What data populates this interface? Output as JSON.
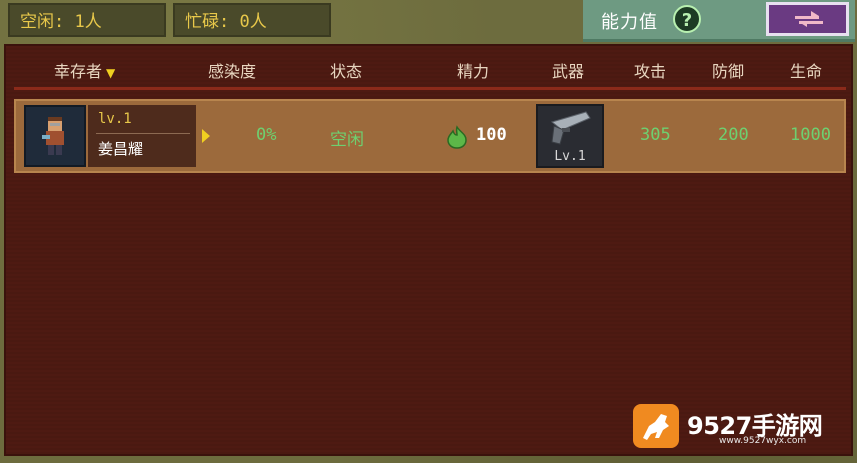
{
  "top_bar": {
    "idle_count": "空闲: 1人",
    "busy_count": "忙碌: 0人",
    "stats_label": "能力值",
    "help_glyph": "?"
  },
  "table": {
    "headers": {
      "survivor": "幸存者",
      "infection": "感染度",
      "status": "状态",
      "energy": "精力",
      "weapon": "武器",
      "attack": "攻击",
      "defense": "防御",
      "health": "生命"
    },
    "rows": [
      {
        "level": "lv.1",
        "name": "姜昌耀",
        "infection": "0%",
        "status": "空闲",
        "energy": "100",
        "weapon_level": "Lv.1",
        "attack": "305",
        "defense": "200",
        "health": "1000"
      }
    ]
  },
  "watermark": {
    "brand": "9527手游网",
    "url": "www.9527wyx.com"
  },
  "icons": {
    "sort": "chevron-down-icon",
    "help": "question-icon",
    "switch": "swap-arrows-icon",
    "energy": "flame-icon",
    "weapon": "pistol-icon",
    "select": "play-arrow-icon"
  },
  "colors": {
    "highlight_text": "#e8c84a",
    "stat_green": "#6ed070",
    "panel_bg": "#4e1a12",
    "row_bg": "#9c6a3c"
  }
}
